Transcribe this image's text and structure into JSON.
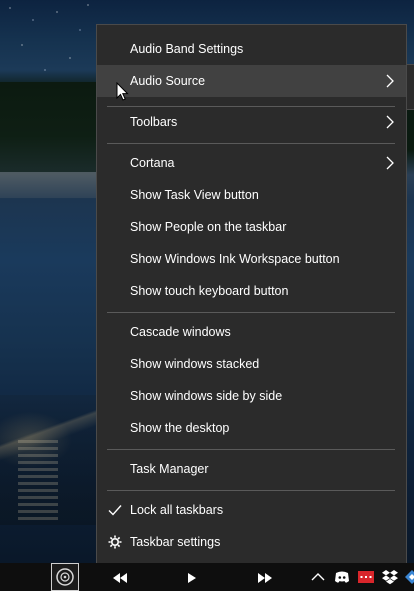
{
  "menu": {
    "items": [
      {
        "label": "Audio Band Settings",
        "submenu": false
      },
      {
        "label": "Audio Source",
        "submenu": true,
        "highlighted": true
      },
      {
        "label": "Toolbars",
        "submenu": true
      },
      {
        "label": "Cortana",
        "submenu": true
      },
      {
        "label": "Show Task View button",
        "submenu": false
      },
      {
        "label": "Show People on the taskbar",
        "submenu": false
      },
      {
        "label": "Show Windows Ink Workspace button",
        "submenu": false
      },
      {
        "label": "Show touch keyboard button",
        "submenu": false
      },
      {
        "label": "Cascade windows",
        "submenu": false
      },
      {
        "label": "Show windows stacked",
        "submenu": false
      },
      {
        "label": "Show windows side by side",
        "submenu": false
      },
      {
        "label": "Show the desktop",
        "submenu": false
      },
      {
        "label": "Task Manager",
        "submenu": false
      },
      {
        "label": "Lock all taskbars",
        "checked": true
      },
      {
        "label": "Taskbar settings",
        "icon": "gear-icon"
      }
    ]
  },
  "taskbar": {
    "pinned_app_icon": "audio-disc-icon",
    "media_controls": [
      "previous-track-icon",
      "play-icon",
      "next-track-icon"
    ],
    "tray_icons": [
      "chevron-up-icon",
      "discord-icon",
      "red-app-icon",
      "dropbox-icon",
      "app-icon"
    ]
  },
  "colors": {
    "menu_bg": "#2b2b2b",
    "menu_hover": "#414141",
    "separator": "#5a5a5a",
    "text": "#ffffff",
    "taskbar_bg": "#0e0e0e",
    "discord": "#7289da",
    "red_app": "#d9262b",
    "dropbox": "#ffffff"
  }
}
